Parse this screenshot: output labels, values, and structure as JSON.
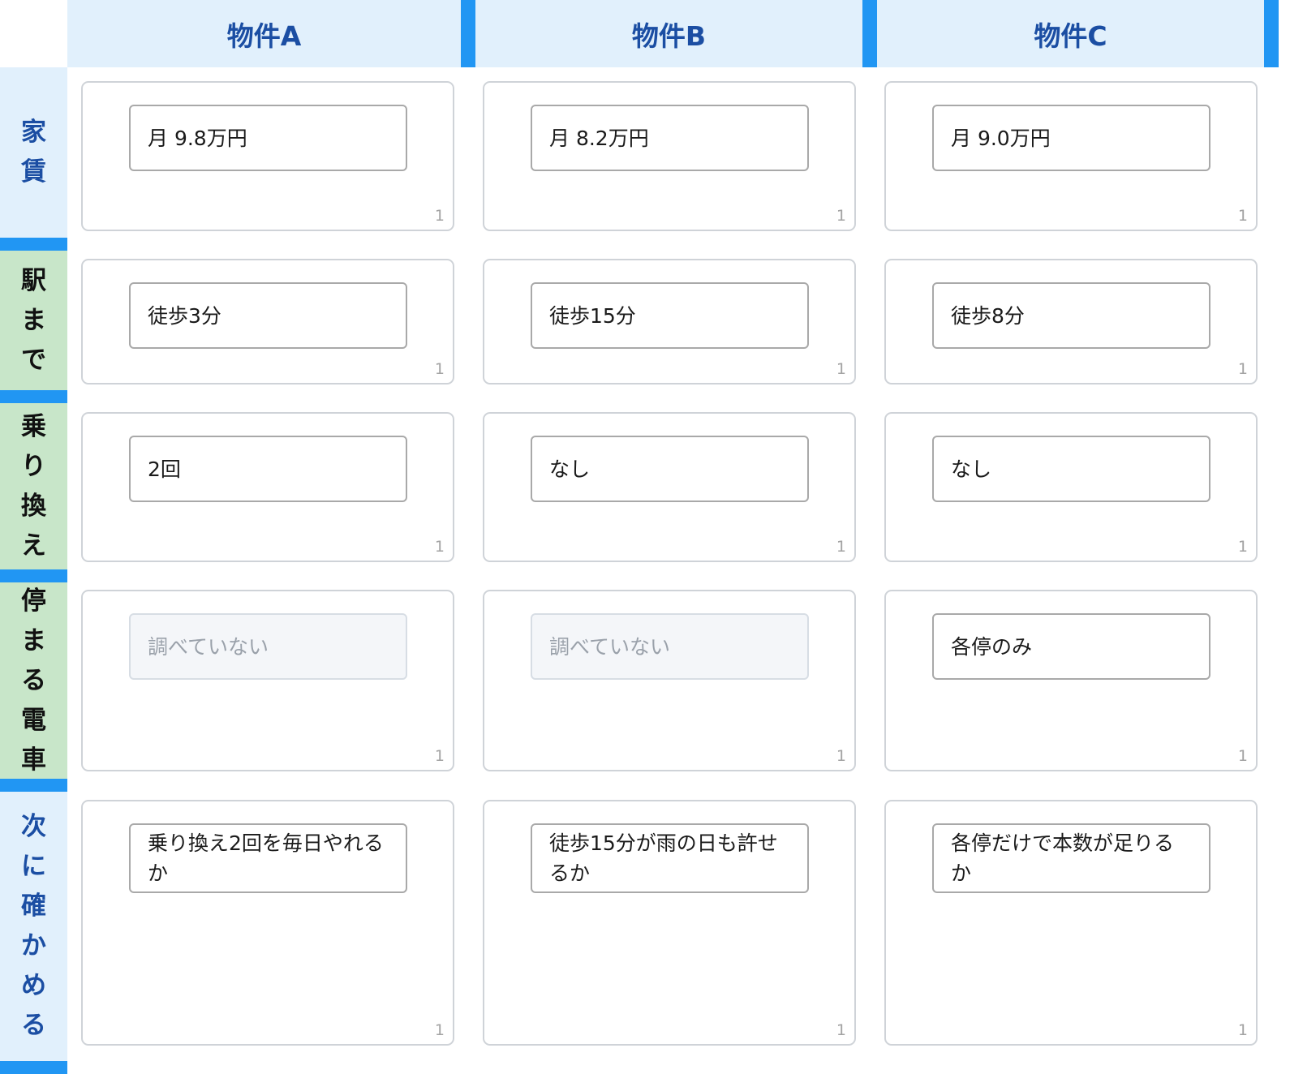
{
  "columns": [
    "物件A",
    "物件B",
    "物件C"
  ],
  "rows": [
    {
      "label": [
        "家",
        "賃"
      ],
      "cells": [
        {
          "value": "月 9.8万円",
          "count": "1"
        },
        {
          "value": "月 8.2万円",
          "count": "1"
        },
        {
          "value": "月 9.0万円",
          "count": "1"
        }
      ]
    },
    {
      "label": [
        "駅",
        "ま",
        "で"
      ],
      "cells": [
        {
          "value": "徒歩3分",
          "count": "1"
        },
        {
          "value": "徒歩15分",
          "count": "1"
        },
        {
          "value": "徒歩8分",
          "count": "1"
        }
      ]
    },
    {
      "label": [
        "乗",
        "り",
        "換",
        "え"
      ],
      "cells": [
        {
          "value": "2回",
          "count": "1"
        },
        {
          "value": "なし",
          "count": "1"
        },
        {
          "value": "なし",
          "count": "1"
        }
      ]
    },
    {
      "label": [
        "停",
        "ま",
        "る",
        "電",
        "車"
      ],
      "cells": [
        {
          "value": "",
          "placeholder": "調べていない",
          "count": "1"
        },
        {
          "value": "",
          "placeholder": "調べていない",
          "count": "1"
        },
        {
          "value": "各停のみ",
          "count": "1"
        }
      ]
    },
    {
      "label": [
        "次",
        "に",
        "確",
        "か",
        "め",
        "る"
      ],
      "cells": [
        {
          "value": "乗り換え2回を毎日やれるか",
          "count": "1"
        },
        {
          "value": "徒歩15分が雨の日も許せるか",
          "count": "1"
        },
        {
          "value": "各停だけで本数が足りるか",
          "count": "1"
        }
      ]
    }
  ],
  "colors": {
    "header_bg": "#e1f0fc",
    "header_text": "#1b4ea3",
    "accent": "#2196f3",
    "green_header_bg": "#c8e6c9"
  }
}
